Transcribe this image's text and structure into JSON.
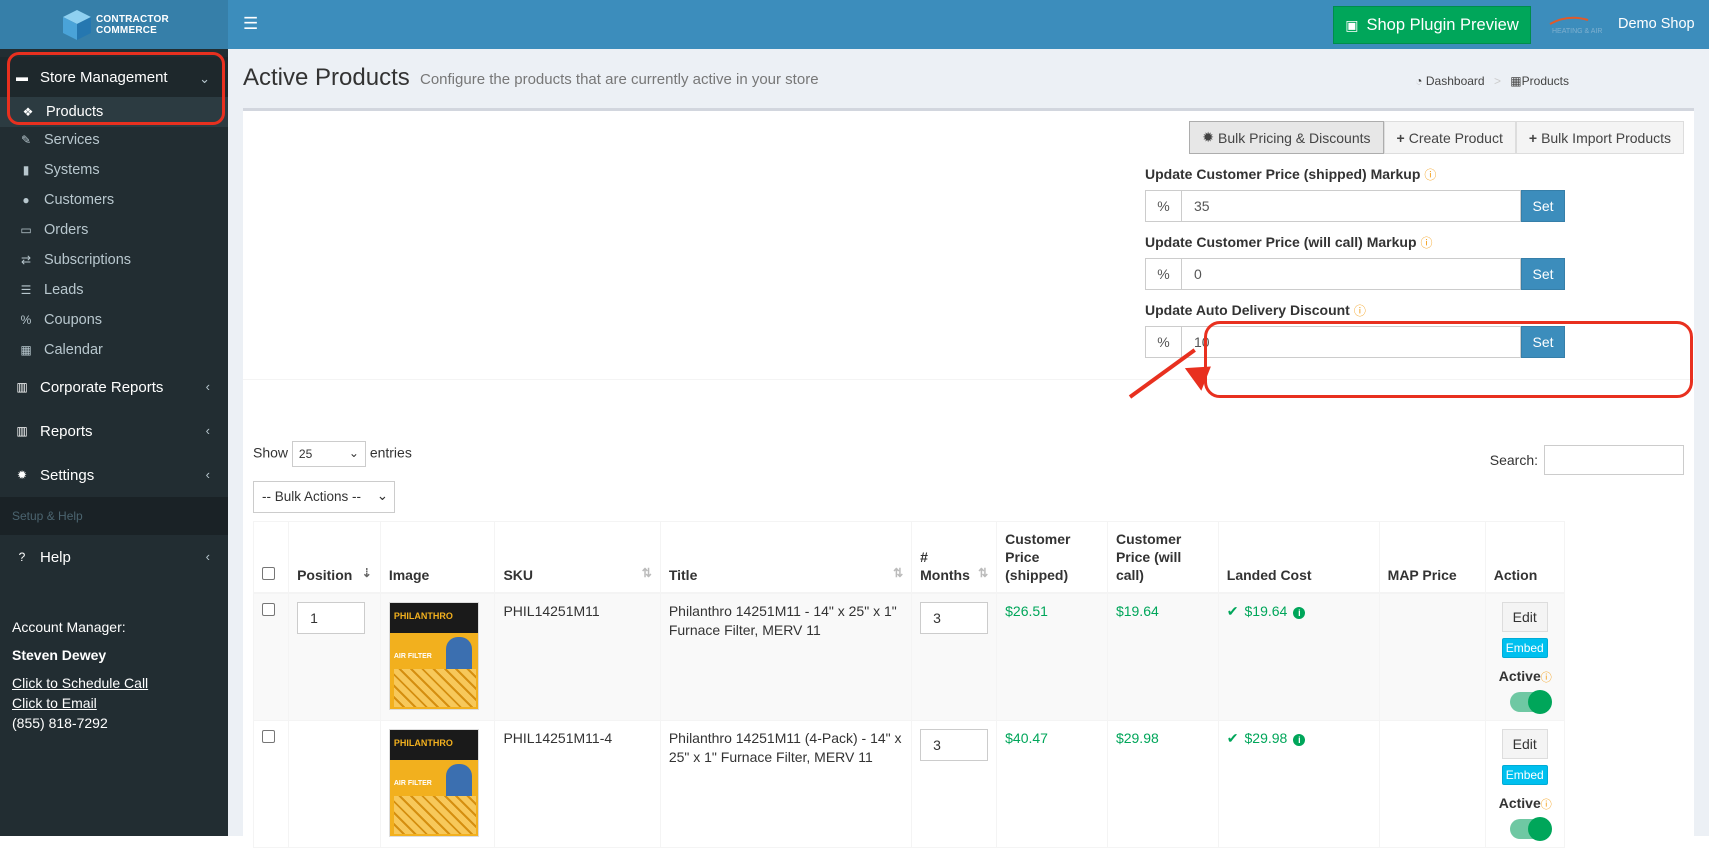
{
  "brand": {
    "line1": "CONTRACTOR",
    "line2": "COMMERCE"
  },
  "sidebar": {
    "store_management": "Store Management",
    "items": [
      {
        "label": "Products",
        "icon": "cubes-icon"
      },
      {
        "label": "Services",
        "icon": "wrench-icon"
      },
      {
        "label": "Systems",
        "icon": "fire-extinguisher-icon"
      },
      {
        "label": "Customers",
        "icon": "users-icon"
      },
      {
        "label": "Orders",
        "icon": "inbox-icon"
      },
      {
        "label": "Subscriptions",
        "icon": "retweet-icon"
      },
      {
        "label": "Leads",
        "icon": "list-icon"
      },
      {
        "label": "Coupons",
        "icon": "percent-icon"
      },
      {
        "label": "Calendar",
        "icon": "calendar-icon"
      }
    ],
    "corporate_reports": "Corporate Reports",
    "reports": "Reports",
    "settings": "Settings",
    "section_setup": "Setup & Help",
    "help": "Help",
    "account": {
      "title": "Account Manager:",
      "name": "Steven Dewey",
      "schedule": "Click to Schedule Call",
      "email": "Click to Email",
      "phone": "(855) 818-7292"
    }
  },
  "topbar": {
    "preview_button": "Shop Plugin Preview",
    "shop_logo_text": "HEATING & AIR",
    "shop_name": "Demo Shop"
  },
  "page": {
    "title": "Active Products",
    "subtitle": "Configure the products that are currently active in your store",
    "breadcrumb": {
      "dashboard": "Dashboard",
      "products": "Products"
    }
  },
  "toolbar": {
    "bulk": "Bulk Pricing & Discounts",
    "create": "Create Product",
    "import": "Bulk Import Products"
  },
  "pricing": {
    "shipped": {
      "label": "Update Customer Price (shipped) Markup",
      "addon": "%",
      "value": "35",
      "button": "Set"
    },
    "willcall": {
      "label": "Update Customer Price (will call) Markup",
      "addon": "%",
      "value": "0",
      "button": "Set"
    },
    "auto": {
      "label": "Update Auto Delivery Discount",
      "addon": "%",
      "value": "10",
      "button": "Set"
    }
  },
  "table_controls": {
    "show": "Show",
    "entries_value": "25",
    "entries": "entries",
    "bulk_actions": "-- Bulk Actions --",
    "search": "Search:"
  },
  "table": {
    "headers": {
      "position": "Position",
      "image": "Image",
      "sku": "SKU",
      "title": "Title",
      "months_1": "#",
      "months_2": "Months",
      "ship_1": "Customer",
      "ship_2": "Price (shipped)",
      "will_1": "Customer",
      "will_2": "Price (will call)",
      "landed": "Landed Cost",
      "map": "MAP Price",
      "action": "Action"
    },
    "rows": [
      {
        "position": "1",
        "sku": "PHIL14251M11",
        "title": "Philanthro 14251M11 - 14\" x 25\" x 1\" Furnace Filter, MERV 11",
        "months": "3",
        "shipped": "$26.51",
        "willcall": "$19.64",
        "landed": "$19.64",
        "edit": "Edit",
        "embed": "Embed",
        "active": "Active"
      },
      {
        "position": "",
        "sku": "PHIL14251M11-4",
        "title": "Philanthro 14251M11 (4-Pack) - 14\" x 25\" x 1\" Furnace Filter, MERV 11",
        "months": "3",
        "shipped": "$40.47",
        "willcall": "$29.98",
        "landed": "$29.98",
        "edit": "Edit",
        "embed": "Embed",
        "active": "Active"
      }
    ],
    "img_brand": "PHILANTHRO",
    "img_text": "AIR FILTER"
  }
}
